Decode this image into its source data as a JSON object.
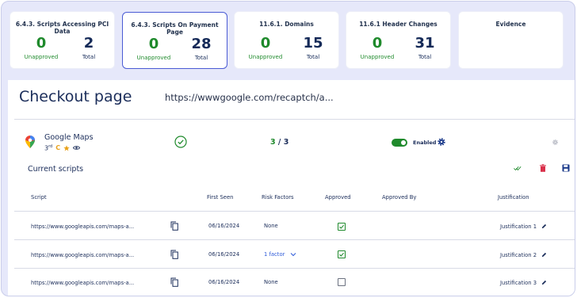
{
  "cards": [
    {
      "title": "6.4.3. Scripts Accessing PCI Data",
      "unapproved": "0",
      "unapproved_label": "Unapproved",
      "total": "2",
      "total_label": "Total",
      "selected": false
    },
    {
      "title": "6.4.3. Scripts On Payment Page",
      "unapproved": "0",
      "unapproved_label": "Unapproved",
      "total": "28",
      "total_label": "Total",
      "selected": true
    },
    {
      "title": "11.6.1. Domains",
      "unapproved": "0",
      "unapproved_label": "Unapproved",
      "total": "15",
      "total_label": "Total",
      "selected": false
    },
    {
      "title": "11.6.1 Header Changes",
      "unapproved": "0",
      "unapproved_label": "Unapproved",
      "total": "31",
      "total_label": "Total",
      "selected": false
    },
    {
      "title": "Evidence",
      "selected": false
    }
  ],
  "page": {
    "title": "Checkout page",
    "url": "https://wwwgoogle.com/recaptch/a..."
  },
  "vendor": {
    "name": "Google Maps",
    "rank": "3",
    "rank_suffix": "rd",
    "grade": "C",
    "ratio_good": "3",
    "ratio_sep": " / ",
    "ratio_total": "3",
    "status": "Enabled"
  },
  "section": {
    "title": "Current scripts"
  },
  "table": {
    "headers": {
      "script": "Script",
      "first_seen": "First Seen",
      "risk": "Risk Factors",
      "approved": "Approved",
      "approved_by": "Approved By",
      "justification": "Justification"
    },
    "rows": [
      {
        "script": "https://www.googleapis.com/maps-a...",
        "first_seen": "06/16/2024",
        "risk": "None",
        "risk_link": false,
        "approved": true,
        "justification": "Justification 1"
      },
      {
        "script": "https://www.googleapis.com/maps-a...",
        "first_seen": "06/16/2024",
        "risk": "1 factor",
        "risk_link": true,
        "approved": true,
        "justification": "Justification 2"
      },
      {
        "script": "https://www.googleapis.com/maps-a...",
        "first_seen": "06/16/2024",
        "risk": "None",
        "risk_link": false,
        "approved": false,
        "justification": "Justification 3"
      }
    ]
  },
  "colors": {
    "accent": "#4a5bd4",
    "success": "#1f8a2c",
    "danger": "#d9304a",
    "navy": "#152a58",
    "background": "#e6e8fa"
  },
  "icons": {
    "vendor": "google-maps-pin-icon",
    "verified": "check-circle-icon",
    "star": "star-icon",
    "eye": "eye-icon",
    "settings": "gear-icon",
    "approve_all": "double-check-icon",
    "delete": "trash-icon",
    "save": "save-icon",
    "copy": "copy-icon",
    "expand": "chevron-down-icon",
    "edit": "pencil-icon"
  }
}
